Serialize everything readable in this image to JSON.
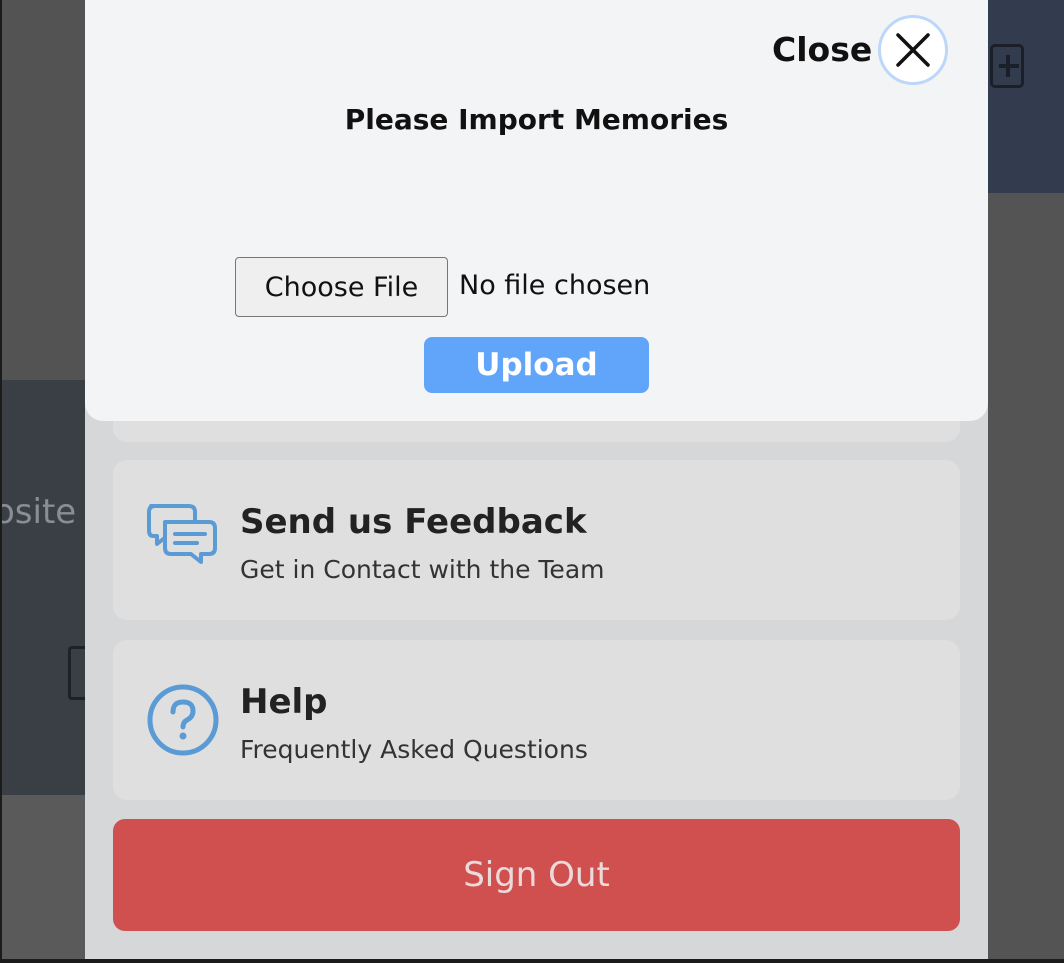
{
  "modal": {
    "close_label": "Close",
    "title": "Please Import Memories",
    "choose_file_label": "Choose File",
    "file_status": "No file chosen",
    "upload_label": "Upload"
  },
  "menu": {
    "feedback": {
      "title": "Send us Feedback",
      "subtitle": "Get in Contact with the Team",
      "icon": "chat-bubbles-icon"
    },
    "help": {
      "title": "Help",
      "subtitle": "Frequently Asked Questions",
      "icon": "question-circle-icon"
    },
    "sign_out_label": "Sign Out"
  },
  "background": {
    "partial_text": "osite"
  },
  "colors": {
    "accent_blue": "#60a5fa",
    "danger_red": "#d05050",
    "icon_blue": "#5b9bd5"
  }
}
